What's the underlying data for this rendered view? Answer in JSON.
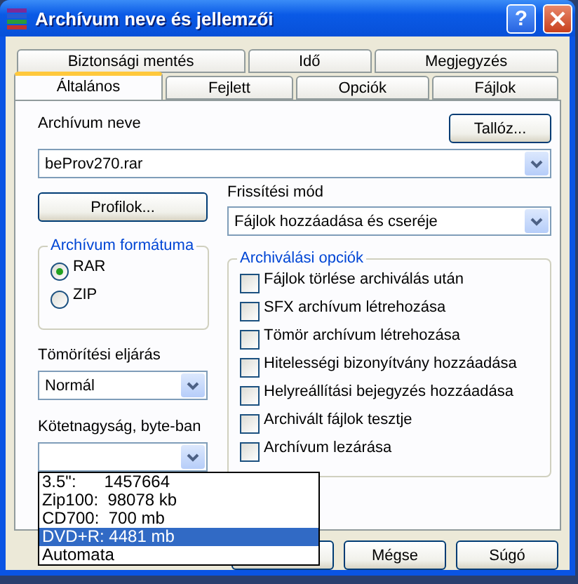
{
  "window": {
    "title": "Archívum neve és jellemzői",
    "help_label": "?"
  },
  "tab_rows": [
    {
      "tabs": [
        {
          "label": "Biztonsági mentés",
          "selected": false
        },
        {
          "label": "Idő",
          "selected": false
        },
        {
          "label": "Megjegyzés",
          "selected": false
        }
      ]
    },
    {
      "tabs": [
        {
          "label": "Általános",
          "selected": true
        },
        {
          "label": "Fejlett",
          "selected": false
        },
        {
          "label": "Opciók",
          "selected": false
        },
        {
          "label": "Fájlok",
          "selected": false
        }
      ]
    }
  ],
  "archive_name": {
    "label": "Archívum neve",
    "value": "beProv270.rar",
    "browse_button": "Tallóz..."
  },
  "profiles_button": "Profilok...",
  "update_mode": {
    "label": "Frissítési mód",
    "value": "Fájlok hozzáadása és cseréje"
  },
  "archive_format": {
    "title": "Archívum formátuma",
    "options": [
      {
        "label": "RAR",
        "selected": true
      },
      {
        "label": "ZIP",
        "selected": false
      }
    ]
  },
  "compression": {
    "label": "Tömörítési eljárás",
    "value": "Normál"
  },
  "volume_size": {
    "label": "Kötetnagyság, byte-ban",
    "list": [
      {
        "label": "3.5\":      1457664",
        "selected": false
      },
      {
        "label": "Zip100:  98078 kb",
        "selected": false
      },
      {
        "label": "CD700:  700 mb",
        "selected": false
      },
      {
        "label": "DVD+R: 4481 mb",
        "selected": true
      },
      {
        "label": "Automata",
        "selected": false
      }
    ]
  },
  "archiving_options": {
    "title": "Archiválási opciók",
    "options": [
      {
        "label": "Fájlok törlése archiválás után",
        "checked": false
      },
      {
        "label": "SFX archívum létrehozása",
        "checked": false
      },
      {
        "label": "Tömör archívum létrehozása",
        "checked": false
      },
      {
        "label": "Hitelességi bizonyítvány hozzáadása",
        "checked": false
      },
      {
        "label": "Helyreállítási bejegyzés hozzáadása",
        "checked": false
      },
      {
        "label": "Archivált fájlok tesztje",
        "checked": false
      },
      {
        "label": "Archívum lezárása",
        "checked": false
      }
    ]
  },
  "buttons": [
    "Mégse",
    "Súgó"
  ]
}
